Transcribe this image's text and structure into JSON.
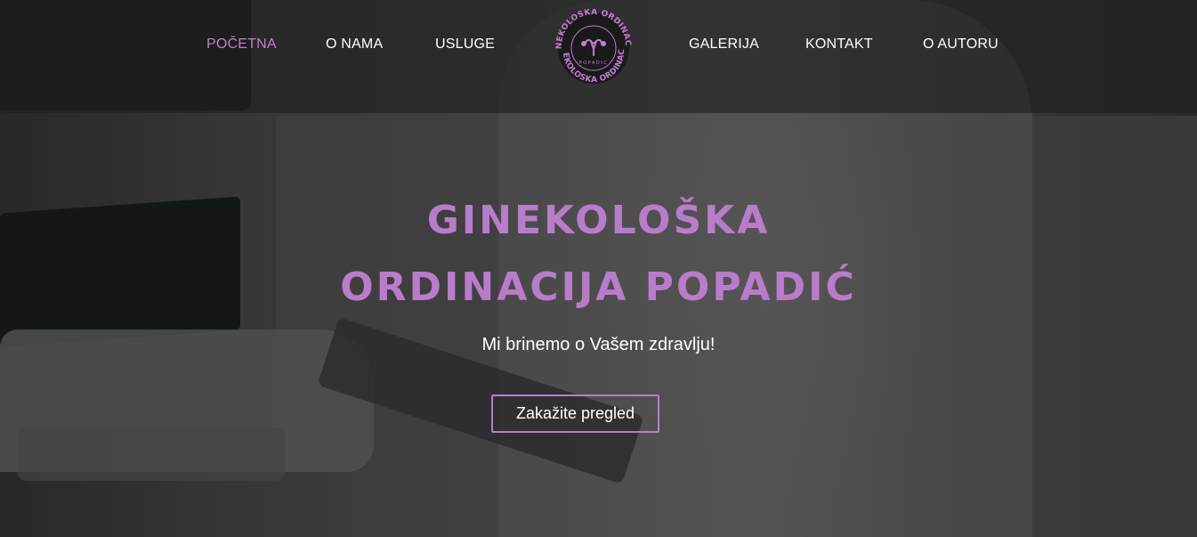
{
  "nav": {
    "items": [
      {
        "label": "POČETNA",
        "active": true
      },
      {
        "label": "O NAMA",
        "active": false
      },
      {
        "label": "USLUGE",
        "active": false
      },
      {
        "label": "GALERIJA",
        "active": false
      },
      {
        "label": "KONTAKT",
        "active": false
      },
      {
        "label": "O AUTORU",
        "active": false
      }
    ],
    "logo": {
      "top_text": "GINEKOLOSKA ORDINACIJA",
      "bottom_text": "GINEKOLOSKA ORDINACIJA",
      "inner_text": "POPADIC",
      "icon": "uterus-icon"
    }
  },
  "hero": {
    "title_line1": "GINEKOLOŠKA",
    "title_line2": "ORDINACIJA POPADIĆ",
    "subtitle": "Mi brinemo o Vašem zdravlju!",
    "cta_label": "Zakažite pregled"
  },
  "colors": {
    "accent": "#b97ccb",
    "active_nav": "#c17fce",
    "text": "#ffffff",
    "navbar_bg": "#1e1e1e"
  }
}
